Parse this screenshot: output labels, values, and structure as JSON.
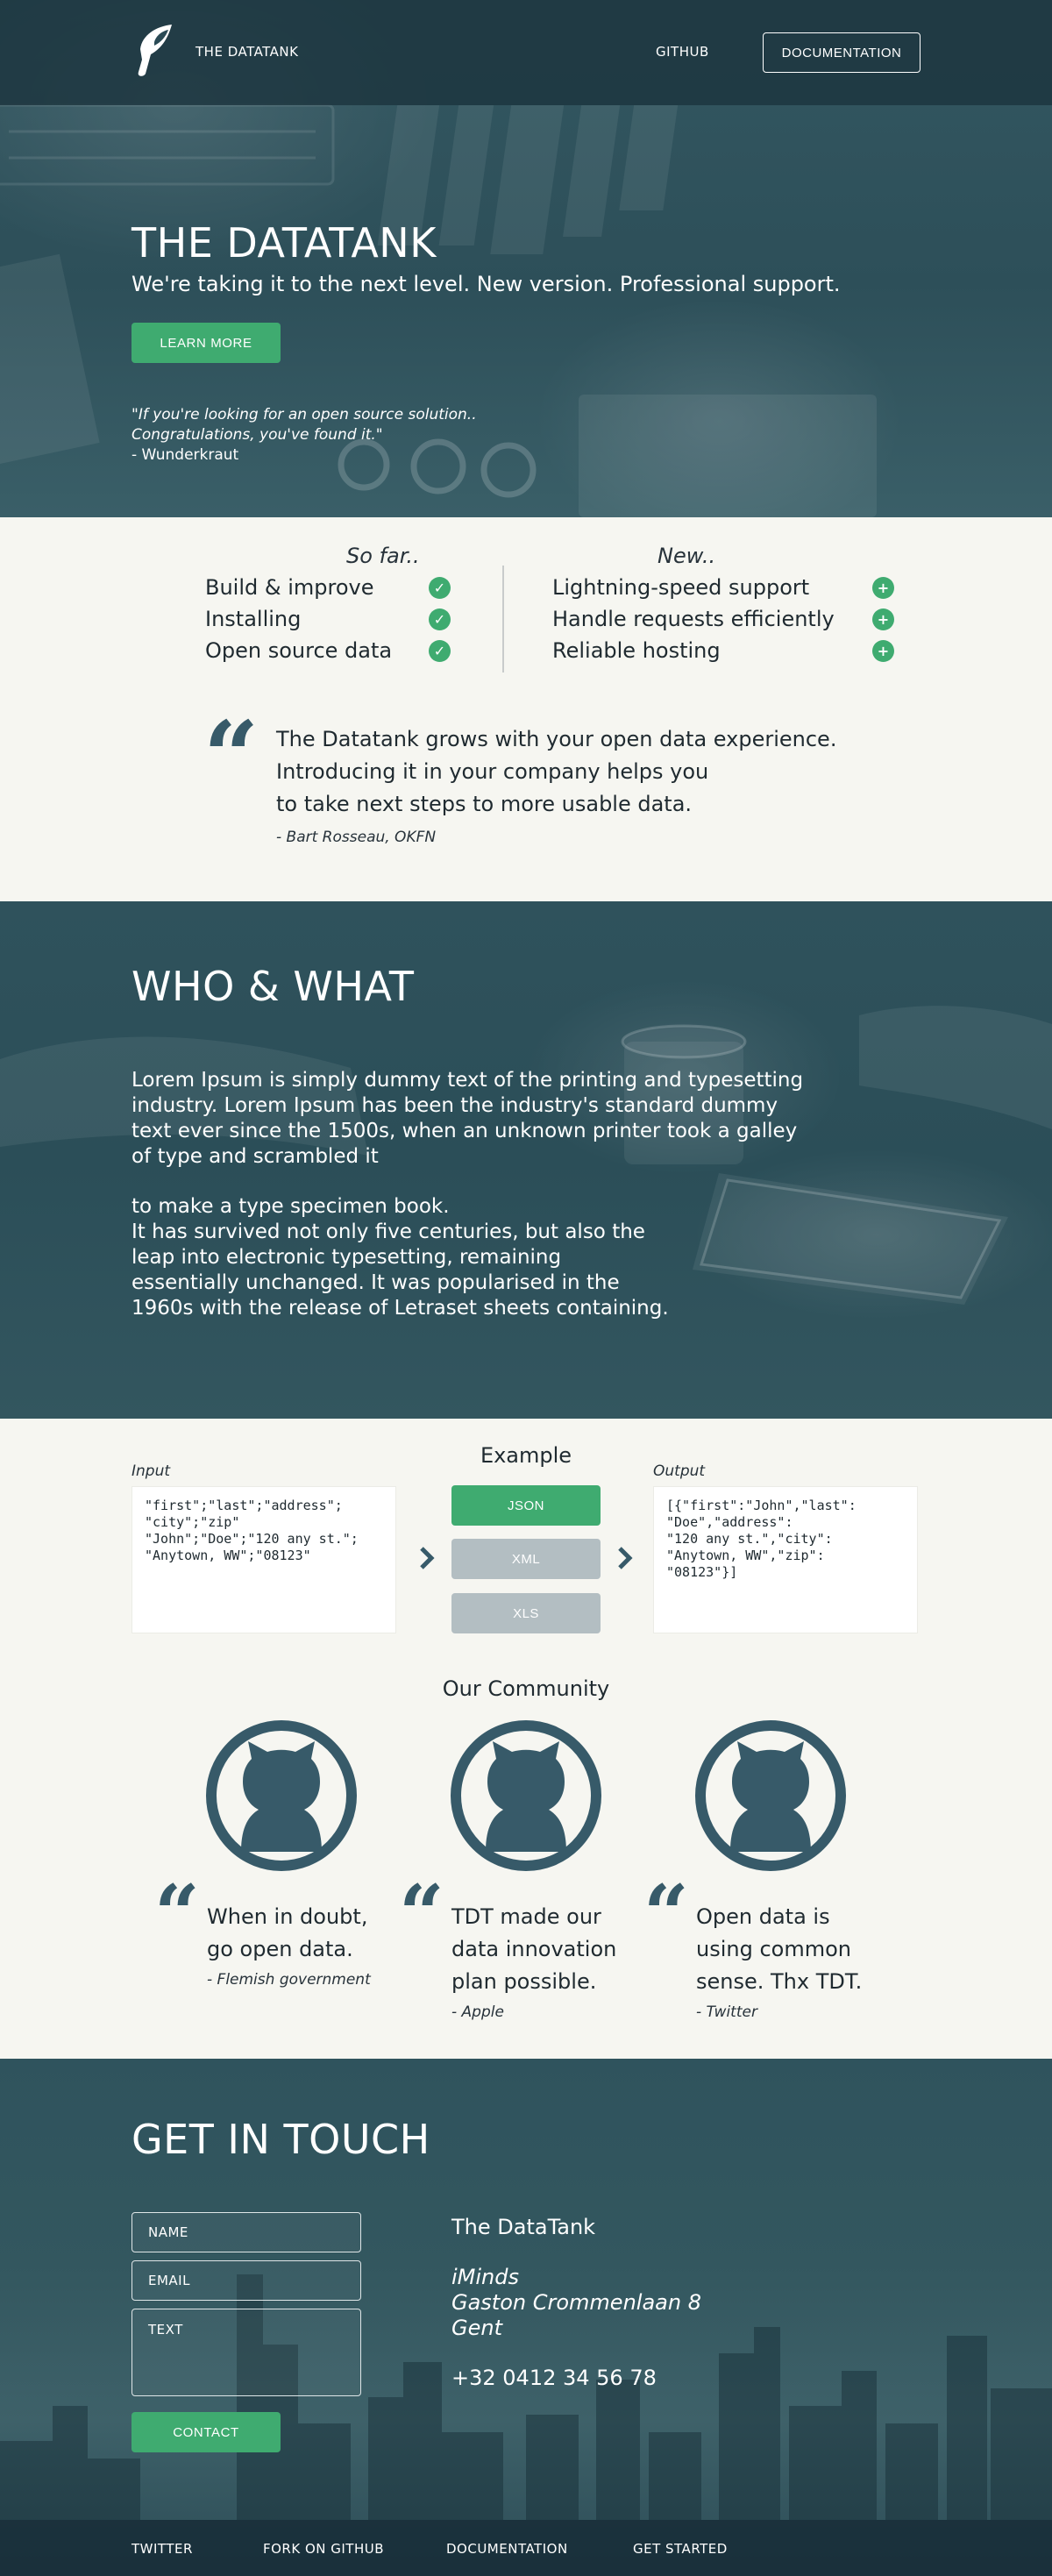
{
  "nav": {
    "brand": "THE DATATANK",
    "github": "GITHUB",
    "documentation": "DOCUMENTATION"
  },
  "hero": {
    "title": "THE DATATANK",
    "subtitle": "We're taking it to the next level. New version. Professional support.",
    "cta": "LEARN MORE",
    "quote_line1": "\"If you're looking for an open source solution..",
    "quote_line2": "Congratulations, you've found it.\"",
    "quote_author": "- Wunderkraut"
  },
  "features": {
    "so_far_title": "So far..",
    "so_far": [
      "Build & improve",
      "Installing",
      "Open source data"
    ],
    "new_title": "New..",
    "new": [
      "Lightning-speed support",
      "Handle requests efficiently",
      "Reliable hosting"
    ],
    "check_icon": "check-circle-icon",
    "plus_icon": "plus-circle-icon"
  },
  "testimonial": {
    "lines": [
      "The Datatank grows with your open data experience.",
      "Introducing it in your company helps you",
      "to take next steps to more usable data."
    ],
    "author": "- Bart Rosseau, OKFN"
  },
  "who": {
    "title": "WHO & WHAT",
    "paragraph1": "Lorem Ipsum is simply dummy text of the printing and typesetting industry. Lorem Ipsum has been the industry's standard dummy text ever since the 1500s, when an unknown printer took a galley of type and scrambled it",
    "paragraph2_line1": "to make a type specimen book.",
    "paragraph2_line2": "It has survived not only five centuries, but also the leap into electronic typesetting, remaining essentially unchanged. It was popularised in the 1960s with the release of Letraset sheets containing."
  },
  "example": {
    "title": "Example",
    "input_label": "Input",
    "output_label": "Output",
    "input_code": "\"first\";\"last\";\"address\";\n\"city\";\"zip\"\n\"John\";\"Doe\";\"120 any st.\";\n\"Anytown, WW\";\"08123\"",
    "output_code": "[{\"first\":\"John\",\"last\":\n\"Doe\",\"address\":\n\"120 any st.\",\"city\":\n\"Anytown, WW\",\"zip\":\n\"08123\"}]",
    "formats": [
      "JSON",
      "XML",
      "XLS"
    ],
    "selected_format": "JSON"
  },
  "community": {
    "title": "Our Community",
    "quotes": [
      {
        "lines": [
          "When in doubt,",
          "go open data."
        ],
        "author": "- Flemish government"
      },
      {
        "lines": [
          "TDT made our",
          "data innovation",
          "plan possible."
        ],
        "author": "- Apple"
      },
      {
        "lines": [
          "Open data is",
          "using common",
          "sense. Thx TDT."
        ],
        "author": "- Twitter"
      }
    ],
    "avatar_icon": "github-octocat-icon"
  },
  "contact": {
    "title": "GET IN TOUCH",
    "name_placeholder": "NAME",
    "email_placeholder": "EMAIL",
    "text_placeholder": "TEXT",
    "submit": "CONTACT",
    "org": "The DataTank",
    "addr1": "iMinds",
    "addr2": "Gaston Crommenlaan 8",
    "addr3": "Gent",
    "phone": "+32 0412 34 56 78"
  },
  "footer": {
    "links": [
      "TWITTER",
      "FORK ON GITHUB",
      "DOCUMENTATION",
      "GET STARTED"
    ]
  },
  "colors": {
    "accent_green": "#3fab70",
    "dark_teal": "#2d4f59",
    "icon_blue": "#375a69",
    "inactive_button": "#b3bec2",
    "page_bg": "#f6f6f1"
  }
}
